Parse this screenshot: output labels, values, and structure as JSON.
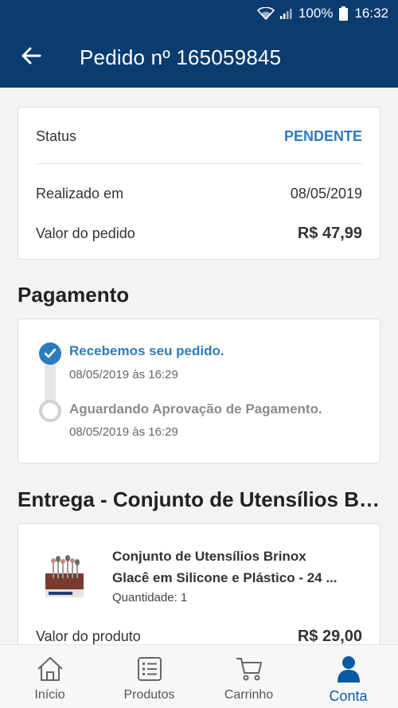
{
  "status_bar": {
    "battery": "100%",
    "time": "16:32"
  },
  "header": {
    "title": "Pedido nº 165059845",
    "back_icon": "arrow-left-icon"
  },
  "summary": {
    "status_label": "Status",
    "status_value": "PENDENTE",
    "date_label": "Realizado em",
    "date_value": "08/05/2019",
    "total_label": "Valor do pedido",
    "total_value": "R$ 47,99"
  },
  "payment": {
    "title": "Pagamento",
    "steps": [
      {
        "label": "Recebemos seu pedido.",
        "time": "08/05/2019 às 16:29",
        "state": "done"
      },
      {
        "label": "Aguardando Aprovação de Pagamento.",
        "time": "08/05/2019 às 16:29",
        "state": "pending"
      }
    ]
  },
  "delivery": {
    "title": "Entrega - Conjunto de Utensílios Brin…",
    "product": {
      "name_line1": "Conjunto de Utensílios Brinox",
      "name_line2": "Glacê em Silicone e Plástico - 24 ...",
      "quantity": "Quantidade: 1",
      "price_label": "Valor do produto",
      "price_value": "R$ 29,00"
    }
  },
  "bottom_nav": {
    "items": [
      {
        "label": "Início",
        "icon": "home-icon"
      },
      {
        "label": "Produtos",
        "icon": "list-icon"
      },
      {
        "label": "Carrinho",
        "icon": "cart-icon"
      },
      {
        "label": "Conta",
        "icon": "user-icon"
      }
    ],
    "active": "Conta"
  },
  "colors": {
    "primary": "#0b3c70",
    "accent": "#2d7bbf",
    "active_nav": "#0b5aa3"
  }
}
